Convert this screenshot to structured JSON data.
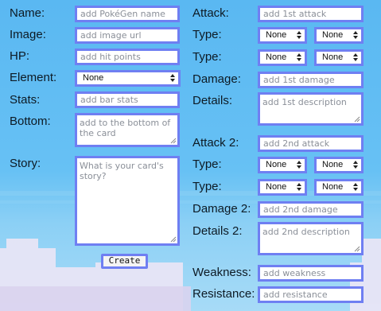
{
  "left": {
    "name": {
      "label": "Name:",
      "placeholder": "add PokéGen name"
    },
    "image": {
      "label": "Image:",
      "placeholder": "add image url"
    },
    "hp": {
      "label": "HP:",
      "placeholder": "add hit points"
    },
    "element": {
      "label": "Element:",
      "value": "None"
    },
    "stats": {
      "label": "Stats:",
      "placeholder": "add bar stats"
    },
    "bottom": {
      "label": "Bottom:",
      "placeholder": "add to the bottom of the card"
    },
    "story": {
      "label": "Story:",
      "placeholder": "What is your card's story?"
    },
    "create_label": "Create"
  },
  "right": {
    "attack1": {
      "label": "Attack:",
      "placeholder": "add 1st attack"
    },
    "type1a": {
      "label": "Type:",
      "left": "None",
      "right": "None"
    },
    "type1b": {
      "label": "Type:",
      "left": "None",
      "right": "None"
    },
    "damage1": {
      "label": "Damage:",
      "placeholder": "add 1st damage"
    },
    "details1": {
      "label": "Details:",
      "placeholder": "add 1st description"
    },
    "attack2": {
      "label": "Attack 2:",
      "placeholder": "add 2nd attack"
    },
    "type2a": {
      "label": "Type:",
      "left": "None",
      "right": "None"
    },
    "type2b": {
      "label": "Type:",
      "left": "None",
      "right": "None"
    },
    "damage2": {
      "label": "Damage 2:",
      "placeholder": "add 2nd damage"
    },
    "details2": {
      "label": "Details 2:",
      "placeholder": "add 2nd description"
    },
    "weakness": {
      "label": "Weakness:",
      "placeholder": "add weakness"
    },
    "resistance": {
      "label": "Resistance:",
      "placeholder": "add resistance"
    }
  },
  "colors": {
    "sky": "#5ab8f2",
    "field_border": "#6f7ff2",
    "cloud": "#ece6f6"
  }
}
